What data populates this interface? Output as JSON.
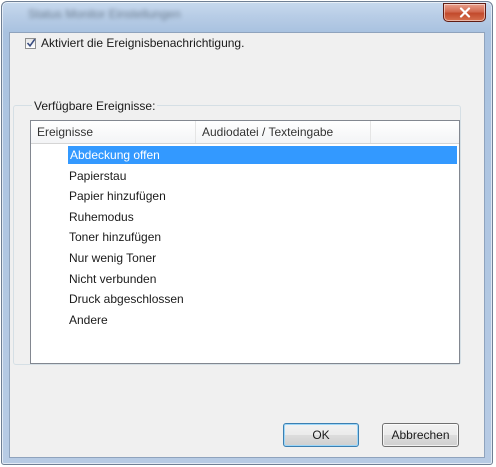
{
  "window": {
    "title": "Status Monitor Einstellungen"
  },
  "notification_checkbox": {
    "label": "Aktiviert die Ereignisbenachrichtigung.",
    "checked": true
  },
  "events_group": {
    "label": "Verfügbare Ereignisse:",
    "columns": [
      "Ereignisse",
      "Audiodatei / Texteingabe"
    ],
    "items": [
      {
        "label": "Abdeckung offen",
        "selected": true
      },
      {
        "label": "Papierstau",
        "selected": false
      },
      {
        "label": "Papier hinzufügen",
        "selected": false
      },
      {
        "label": "Ruhemodus",
        "selected": false
      },
      {
        "label": "Toner hinzufügen",
        "selected": false
      },
      {
        "label": "Nur wenig Toner",
        "selected": false
      },
      {
        "label": "Nicht verbunden",
        "selected": false
      },
      {
        "label": "Druck abgeschlossen",
        "selected": false
      },
      {
        "label": "Andere",
        "selected": false
      }
    ]
  },
  "buttons": {
    "ok_label": "OK",
    "cancel_label": "Abbrechen"
  },
  "colors": {
    "selection": "#3399ff",
    "close_button": "#c24a2c"
  }
}
